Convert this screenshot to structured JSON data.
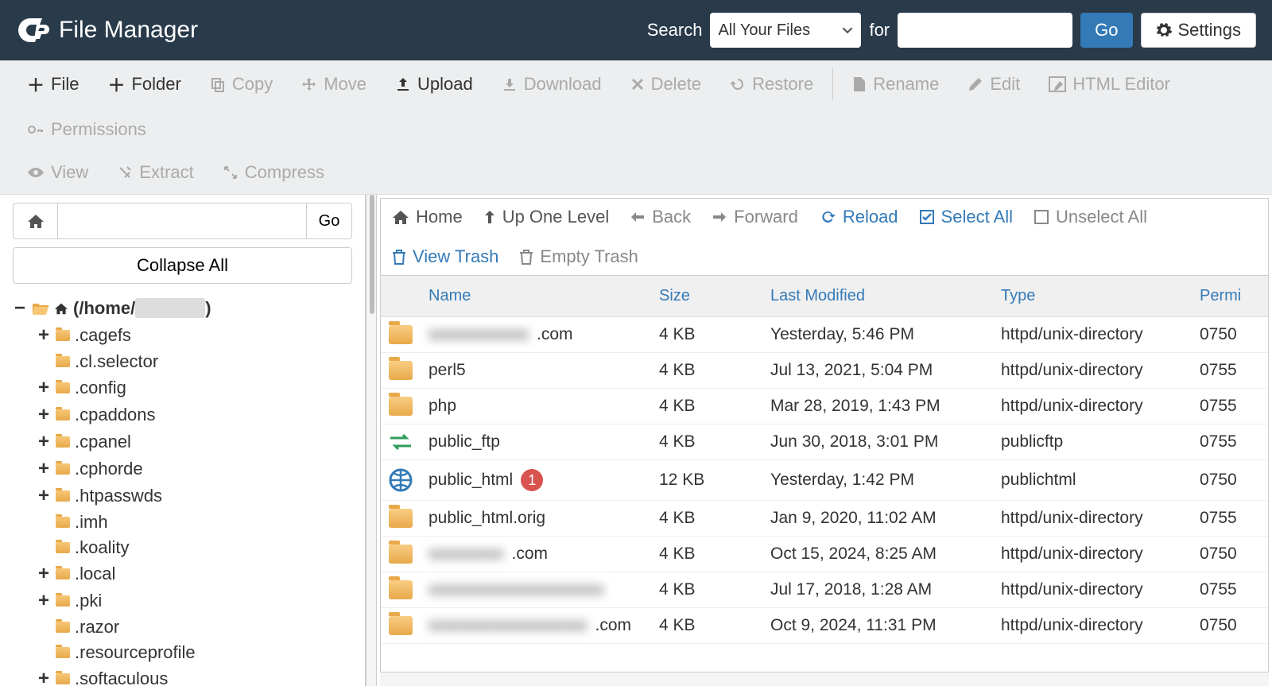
{
  "header": {
    "app_title": "File Manager",
    "search_label": "Search",
    "select_value": "All Your Files",
    "for_label": "for",
    "go_label": "Go",
    "settings_label": "Settings"
  },
  "toolbar": {
    "file": "File",
    "folder": "Folder",
    "copy": "Copy",
    "move": "Move",
    "upload": "Upload",
    "download": "Download",
    "delete": "Delete",
    "restore": "Restore",
    "rename": "Rename",
    "edit": "Edit",
    "html_editor": "HTML Editor",
    "permissions": "Permissions",
    "view": "View",
    "extract": "Extract",
    "compress": "Compress"
  },
  "sidebar": {
    "go_label": "Go",
    "collapse_label": "Collapse All",
    "root_prefix": "(/home/",
    "root_blur": "XXXXXX",
    "root_suffix": ")",
    "items": [
      {
        "label": ".cagefs",
        "expandable": true
      },
      {
        "label": ".cl.selector",
        "expandable": false
      },
      {
        "label": ".config",
        "expandable": true
      },
      {
        "label": ".cpaddons",
        "expandable": true
      },
      {
        "label": ".cpanel",
        "expandable": true
      },
      {
        "label": ".cphorde",
        "expandable": true
      },
      {
        "label": ".htpasswds",
        "expandable": true
      },
      {
        "label": ".imh",
        "expandable": false
      },
      {
        "label": ".koality",
        "expandable": false
      },
      {
        "label": ".local",
        "expandable": true
      },
      {
        "label": ".pki",
        "expandable": true
      },
      {
        "label": ".razor",
        "expandable": false
      },
      {
        "label": ".resourceprofile",
        "expandable": false
      },
      {
        "label": ".softaculous",
        "expandable": true
      }
    ]
  },
  "nav": {
    "home": "Home",
    "up": "Up One Level",
    "back": "Back",
    "forward": "Forward",
    "reload": "Reload",
    "select_all": "Select All",
    "unselect_all": "Unselect All",
    "view_trash": "View Trash",
    "empty_trash": "Empty Trash"
  },
  "grid": {
    "headers": {
      "name": "Name",
      "size": "Size",
      "mod": "Last Modified",
      "type": "Type",
      "perm": "Permi"
    },
    "rows": [
      {
        "icon": "folder",
        "name_blur": "xxxxxxxxxxxx",
        "name_suffix": ".com",
        "size": "4 KB",
        "mod": "Yesterday, 5:46 PM",
        "type": "httpd/unix-directory",
        "perm": "0750"
      },
      {
        "icon": "folder",
        "name": "perl5",
        "size": "4 KB",
        "mod": "Jul 13, 2021, 5:04 PM",
        "type": "httpd/unix-directory",
        "perm": "0755"
      },
      {
        "icon": "folder",
        "name": "php",
        "size": "4 KB",
        "mod": "Mar 28, 2019, 1:43 PM",
        "type": "httpd/unix-directory",
        "perm": "0755"
      },
      {
        "icon": "ftp",
        "name": "public_ftp",
        "size": "4 KB",
        "mod": "Jun 30, 2018, 3:01 PM",
        "type": "publicftp",
        "perm": "0755"
      },
      {
        "icon": "html",
        "name": "public_html",
        "badge": "1",
        "size": "12 KB",
        "mod": "Yesterday, 1:42 PM",
        "type": "publichtml",
        "perm": "0750"
      },
      {
        "icon": "folder",
        "name": "public_html.orig",
        "size": "4 KB",
        "mod": "Jan 9, 2020, 11:02 AM",
        "type": "httpd/unix-directory",
        "perm": "0755"
      },
      {
        "icon": "folder",
        "name_blur": "xxxxxxxxx",
        "name_suffix": ".com",
        "size": "4 KB",
        "mod": "Oct 15, 2024, 8:25 AM",
        "type": "httpd/unix-directory",
        "perm": "0750"
      },
      {
        "icon": "folder",
        "name_blur": "xxxxxxxxxxxxxxxxxxxxx",
        "size": "4 KB",
        "mod": "Jul 17, 2018, 1:28 AM",
        "type": "httpd/unix-directory",
        "perm": "0755"
      },
      {
        "icon": "folder",
        "name_blur": "xxxxxxxxxxxxxxxxxxx",
        "name_suffix": ".com",
        "size": "4 KB",
        "mod": "Oct 9, 2024, 11:31 PM",
        "type": "httpd/unix-directory",
        "perm": "0750"
      }
    ]
  }
}
